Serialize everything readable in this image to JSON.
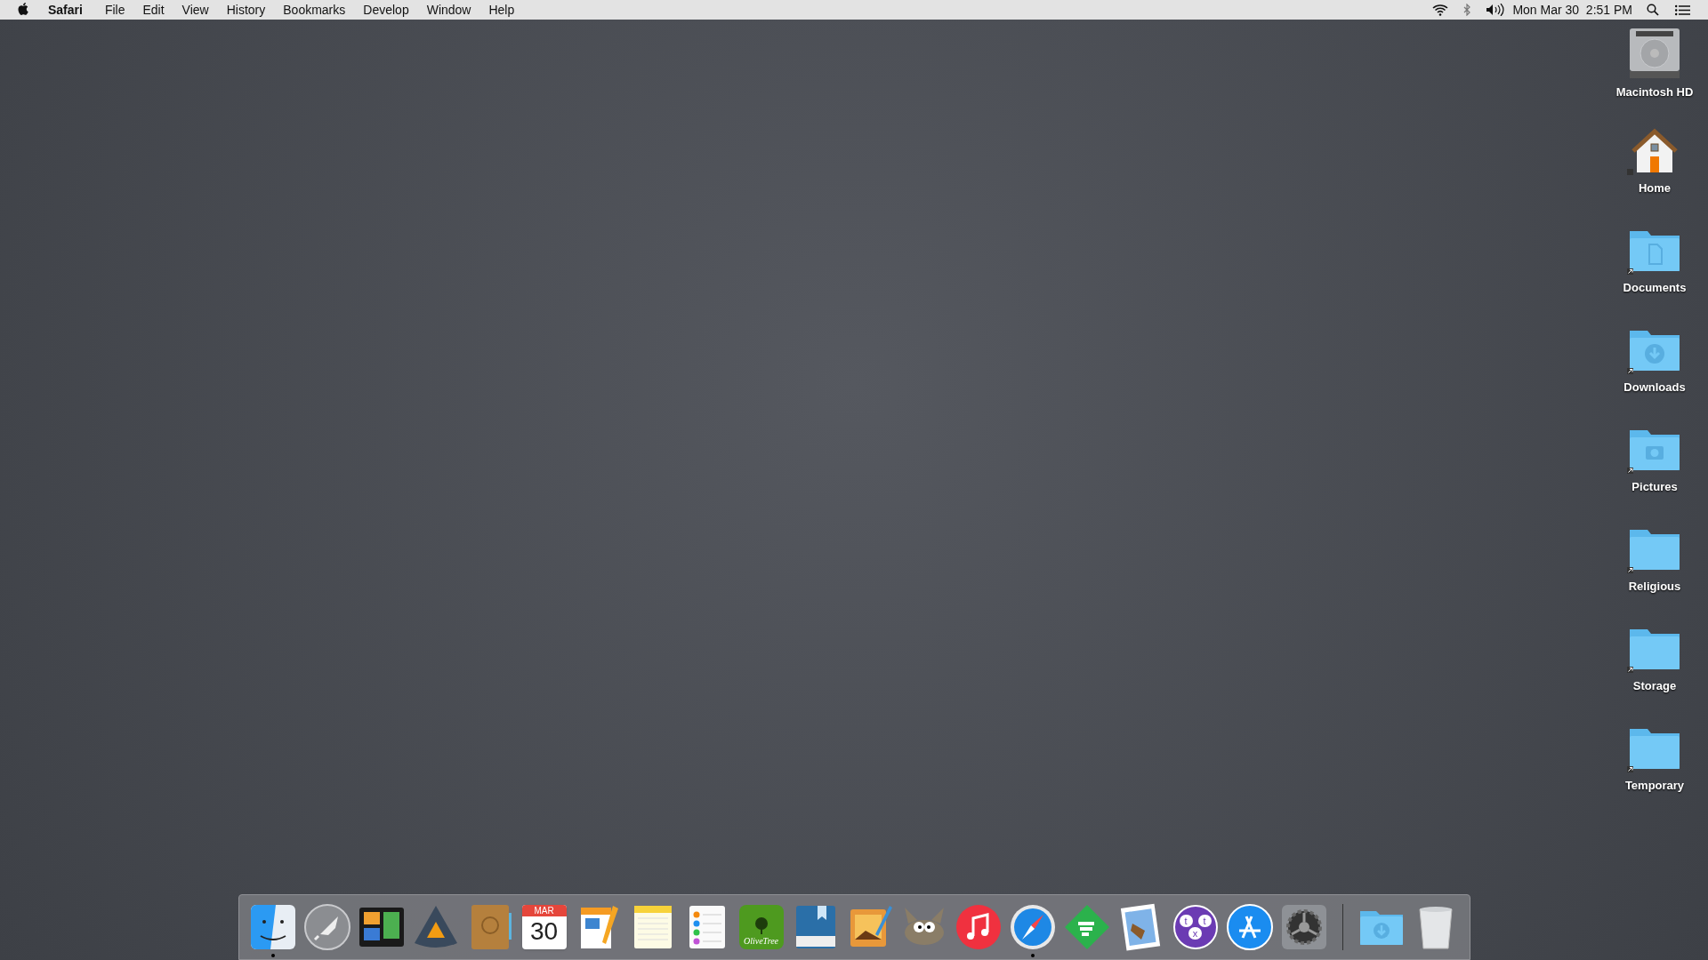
{
  "menu_bar": {
    "app_name": "Safari",
    "menus": [
      "File",
      "Edit",
      "View",
      "History",
      "Bookmarks",
      "Develop",
      "Window",
      "Help"
    ],
    "clock": "Mon Mar 30  2:51 PM"
  },
  "desktop_icons": [
    {
      "label": "Macintosh HD",
      "kind": "drive"
    },
    {
      "label": "Home",
      "kind": "home"
    },
    {
      "label": "Documents",
      "kind": "documents"
    },
    {
      "label": "Downloads",
      "kind": "downloads"
    },
    {
      "label": "Pictures",
      "kind": "pictures"
    },
    {
      "label": "Religious",
      "kind": "folder"
    },
    {
      "label": "Storage",
      "kind": "folder"
    },
    {
      "label": "Temporary",
      "kind": "folder"
    }
  ],
  "dock": {
    "apps": [
      {
        "kind": "finder",
        "running": true
      },
      {
        "kind": "rocket",
        "running": false
      },
      {
        "kind": "mission",
        "running": false
      },
      {
        "kind": "triangle",
        "running": false
      },
      {
        "kind": "contacts",
        "running": false
      },
      {
        "kind": "calendar",
        "running": false,
        "month": "MAR",
        "day": "30"
      },
      {
        "kind": "pages",
        "running": false
      },
      {
        "kind": "notes",
        "running": false
      },
      {
        "kind": "reminders",
        "running": false
      },
      {
        "kind": "olivetree",
        "running": false,
        "logo": "OliveTree"
      },
      {
        "kind": "book",
        "running": false
      },
      {
        "kind": "photo",
        "running": false
      },
      {
        "kind": "gimp",
        "running": false
      },
      {
        "kind": "music",
        "running": false
      },
      {
        "kind": "compass",
        "running": true
      },
      {
        "kind": "feedly",
        "running": false
      },
      {
        "kind": "mail",
        "running": false
      },
      {
        "kind": "chat",
        "running": false,
        "letters": [
          "t",
          "t",
          "x"
        ]
      },
      {
        "kind": "appstore",
        "running": false
      },
      {
        "kind": "gear",
        "running": false
      }
    ],
    "stack": [
      {
        "kind": "downloads-folder"
      },
      {
        "kind": "trash"
      }
    ]
  }
}
